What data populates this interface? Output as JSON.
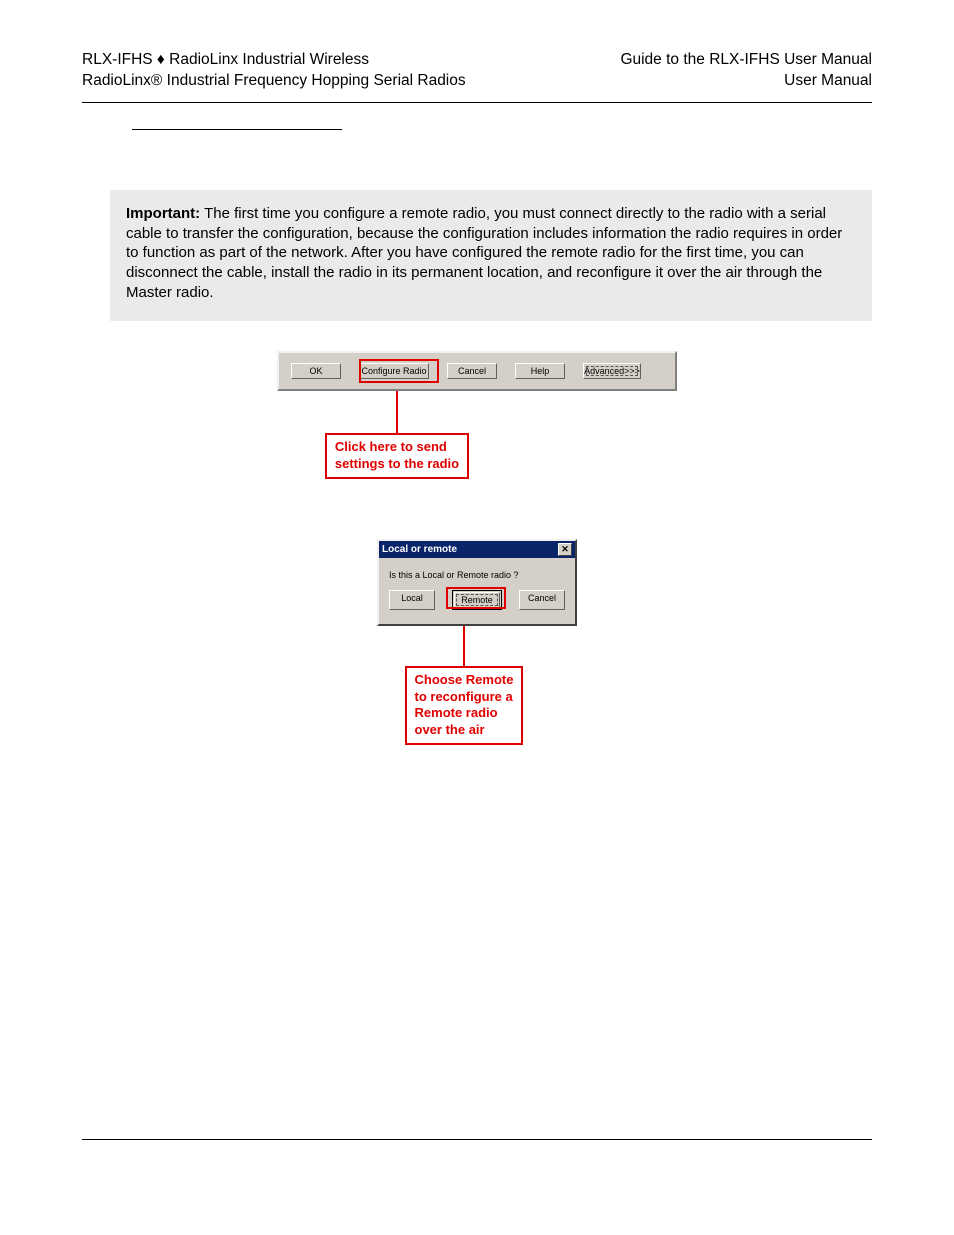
{
  "header": {
    "left_line1": "RLX-IFHS ♦ RadioLinx Industrial Wireless",
    "left_line2": "RadioLinx® Industrial Frequency Hopping Serial Radios",
    "right_line1": "Guide to the RLX-IFHS User Manual",
    "right_line2": "User Manual"
  },
  "important": {
    "label": "Important:",
    "text": " The first time you configure a remote radio, you must connect directly to the radio with a serial cable to transfer the configuration, because the configuration includes information the radio requires in order to function as part of the network. After you have configured the remote radio for the first time, you can disconnect the cable, install the radio in its permanent location, and reconfigure it over the air through the Master radio."
  },
  "toolbar": {
    "ok": "OK",
    "configure": "Configure Radio",
    "cancel": "Cancel",
    "help": "Help",
    "advanced": "Advanced>>>"
  },
  "callout1": {
    "line1": "Click here to send",
    "line2": "settings to the radio"
  },
  "dialog": {
    "title": "Local or remote",
    "question": "Is this a Local or Remote radio ?",
    "local": "Local",
    "remote": "Remote",
    "cancel": "Cancel"
  },
  "callout2": {
    "line1": "Choose Remote",
    "line2": "to reconfigure a",
    "line3": "Remote radio",
    "line4": "over the air"
  }
}
